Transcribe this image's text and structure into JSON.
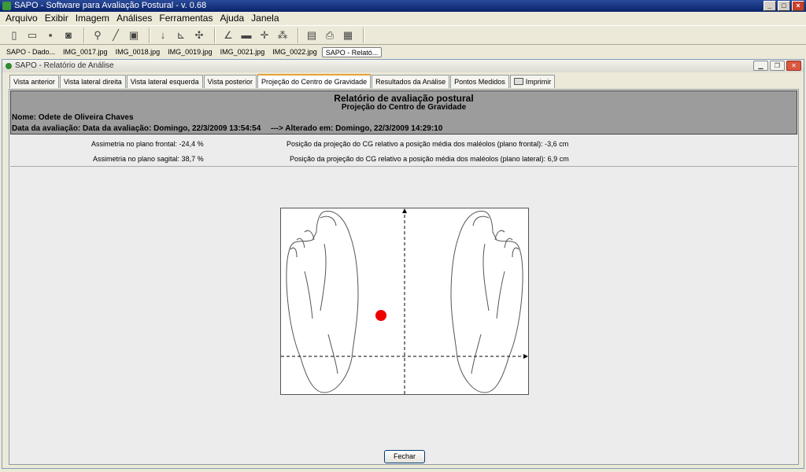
{
  "window": {
    "title": "SAPO - Software para Avaliação Postural - v. 0.68"
  },
  "menu": [
    "Arquivo",
    "Exibir",
    "Imagem",
    "Análises",
    "Ferramentas",
    "Ajuda",
    "Janela"
  ],
  "doc_tabs": [
    "SAPO - Dado...",
    "IMG_0017.jpg",
    "IMG_0018.jpg",
    "IMG_0019.jpg",
    "IMG_0021.jpg",
    "IMG_0022.jpg",
    "SAPO - Relató..."
  ],
  "inner": {
    "title": "SAPO - Relatório de Análise"
  },
  "tabs": [
    "Vista anterior",
    "Vista lateral direita",
    "Vista lateral esquerda",
    "Vista posterior",
    "Projeção do Centro de Gravidade",
    "Resultados da Análise",
    "Pontos Medidos",
    "Imprimir"
  ],
  "report": {
    "title": "Relatório de avaliação postural",
    "subtitle": "Projeção do Centro de Gravidade",
    "name": "Nome: Odete de Oliveira Chaves",
    "date": "Data da avaliação: Data da avaliação: Domingo, 22/3/2009 13:54:54",
    "altered": "--->   Alterado em: Domingo, 22/3/2009 14:29:10",
    "asym_frontal": "Assimetria no plano frontal: -24,4 %",
    "cg_frontal": "Posição da projeção do CG relativo a posição média dos maléolos (plano frontal): -3,6 cm",
    "asym_sagital": "Assimetria no plano sagital: 38,7 %",
    "cg_lateral": "Posição da projeção do CG relativo a posição média dos maléolos (plano lateral): 6,9 cm"
  },
  "buttons": {
    "close": "Fechar"
  },
  "colors": {
    "cg_point": "#ee0000"
  }
}
